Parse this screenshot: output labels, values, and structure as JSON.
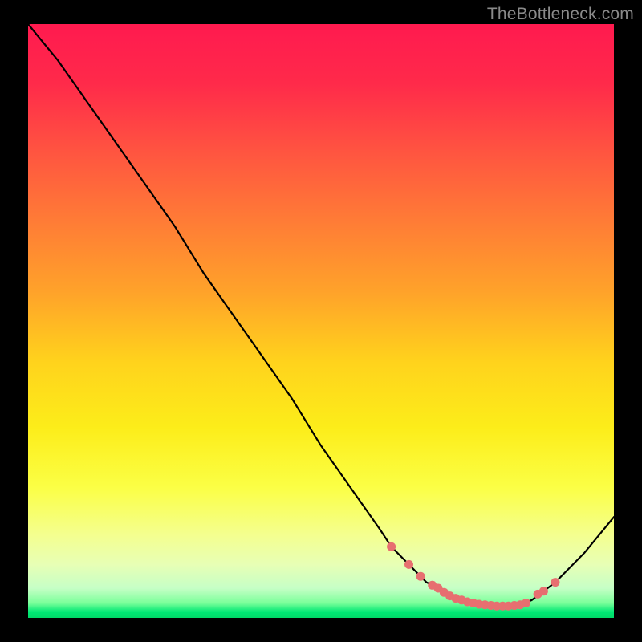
{
  "watermark": "TheBottleneck.com",
  "chart_data": {
    "type": "line",
    "title": "",
    "xlabel": "",
    "ylabel": "",
    "xlim": [
      0,
      100
    ],
    "ylim": [
      0,
      100
    ],
    "grid": false,
    "series": [
      {
        "name": "curve",
        "x": [
          0,
          5,
          10,
          15,
          20,
          25,
          30,
          35,
          40,
          45,
          50,
          55,
          60,
          62,
          65,
          68,
          70,
          72,
          74,
          76,
          78,
          80,
          82,
          84,
          86,
          88,
          90,
          95,
          100
        ],
        "y": [
          100,
          94,
          87,
          80,
          73,
          66,
          58,
          51,
          44,
          37,
          29,
          22,
          15,
          12,
          9,
          6,
          5,
          4,
          3,
          2.5,
          2,
          2,
          2,
          2.2,
          3,
          4.5,
          6,
          11,
          17
        ]
      }
    ],
    "markers": {
      "name": "highlight-points",
      "x": [
        62,
        65,
        67,
        69,
        70,
        71,
        72,
        73,
        74,
        75,
        76,
        77,
        78,
        79,
        80,
        81,
        82,
        83,
        84,
        85,
        87,
        88,
        90
      ],
      "y": [
        12,
        9,
        7,
        5.5,
        5,
        4.3,
        3.7,
        3.3,
        3,
        2.7,
        2.5,
        2.3,
        2.2,
        2.1,
        2,
        2,
        2,
        2.1,
        2.2,
        2.5,
        4,
        4.5,
        6
      ]
    }
  }
}
